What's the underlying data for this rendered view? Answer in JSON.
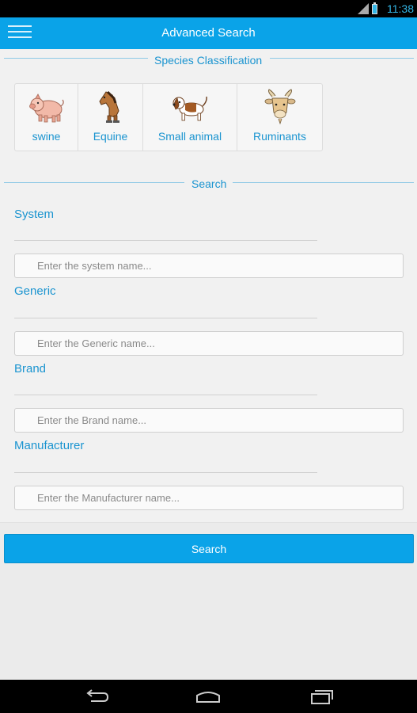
{
  "status_bar": {
    "time": "11:38"
  },
  "action_bar": {
    "title": "Advanced Search",
    "menu_icon": "hamburger-menu-icon"
  },
  "species_classification": {
    "legend": "Species Classification",
    "items": [
      {
        "label": "swine",
        "icon": "pig-icon"
      },
      {
        "label": "Equine",
        "icon": "horse-icon"
      },
      {
        "label": "Small animal",
        "icon": "dog-icon"
      },
      {
        "label": "Ruminants",
        "icon": "goat-icon"
      }
    ]
  },
  "search_section": {
    "legend": "Search",
    "fields": [
      {
        "label": "System",
        "placeholder": "Enter the system name...",
        "value": ""
      },
      {
        "label": "Generic",
        "placeholder": "Enter the Generic name...",
        "value": ""
      },
      {
        "label": "Brand",
        "placeholder": "Enter the Brand name...",
        "value": ""
      },
      {
        "label": "Manufacturer",
        "placeholder": "Enter the Manufacturer name...",
        "value": ""
      }
    ],
    "button_label": "Search"
  },
  "nav_bar": {
    "back_icon": "back-icon",
    "home_icon": "home-icon",
    "recents_icon": "recents-icon"
  },
  "colors": {
    "accent": "#0aa3e8",
    "label_blue": "#1a94d0",
    "background": "#ebebeb"
  }
}
